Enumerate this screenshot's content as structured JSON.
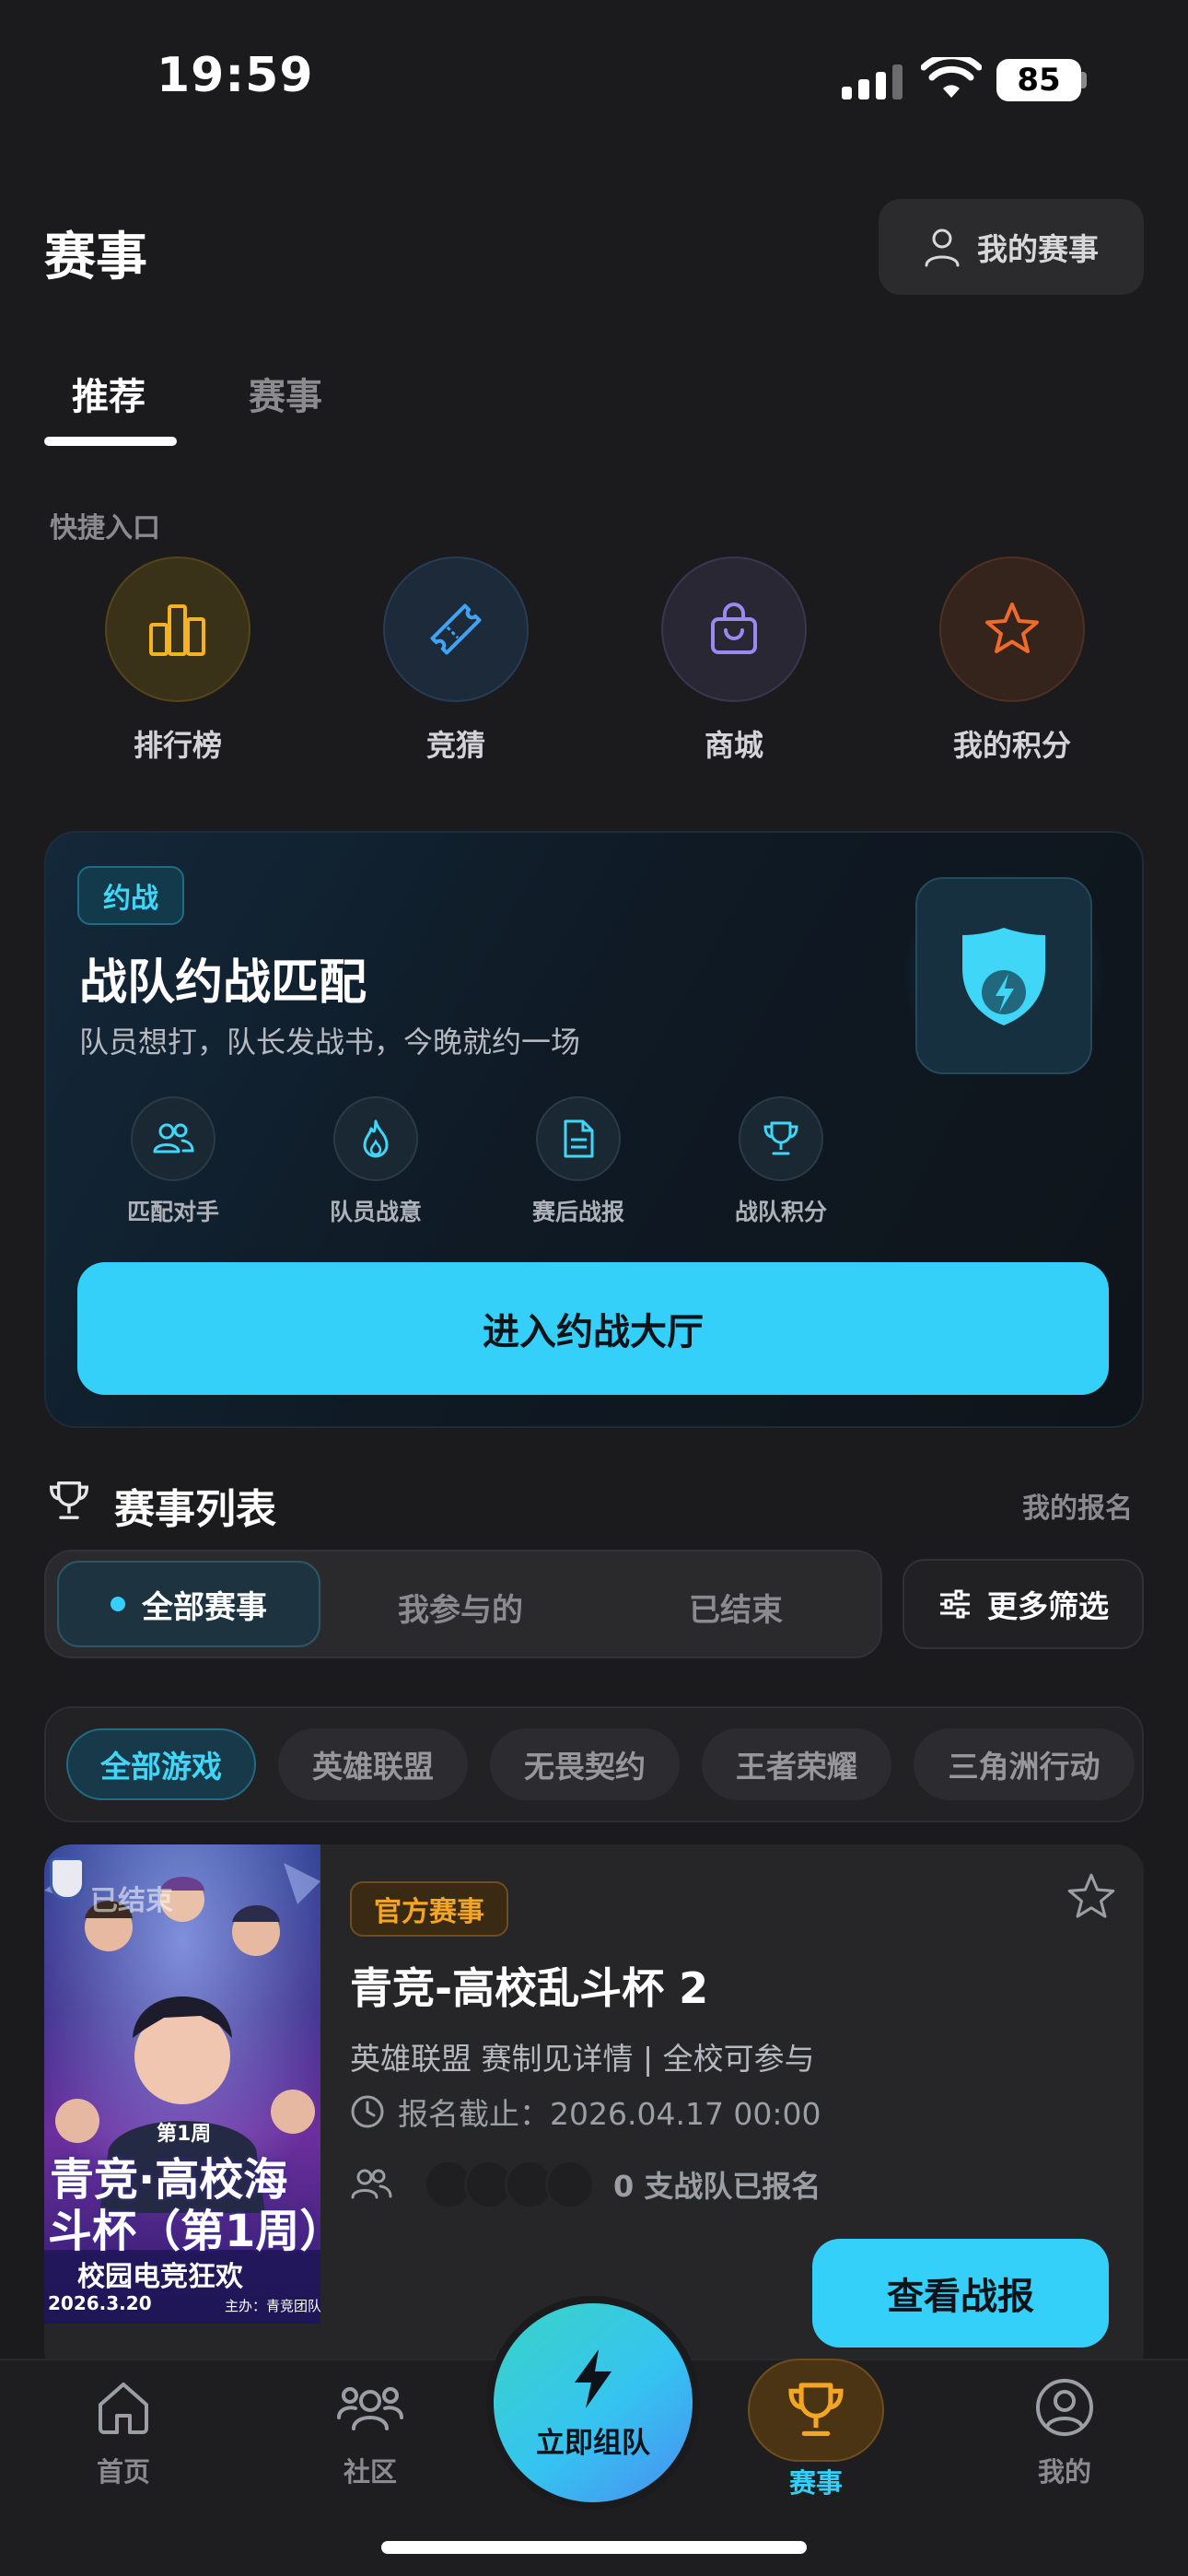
{
  "status_bar": {
    "time": "19:59",
    "battery": "85"
  },
  "header": {
    "title": "赛事",
    "my_events_label": "我的赛事"
  },
  "tabs": [
    {
      "label": "推荐"
    },
    {
      "label": "赛事"
    }
  ],
  "quick_entry": {
    "label": "快捷入口",
    "items": [
      {
        "label": "排行榜",
        "icon": "bar-chart-icon",
        "color": "#f5b324"
      },
      {
        "label": "竞猜",
        "icon": "ticket-icon",
        "color": "#3fa4f7"
      },
      {
        "label": "商城",
        "icon": "shopping-bag-icon",
        "color": "#9a8af0"
      },
      {
        "label": "我的积分",
        "icon": "star-icon",
        "color": "#f06a2a"
      }
    ]
  },
  "battle_card": {
    "badge": "约战",
    "title": "战队约战匹配",
    "subtitle": "队员想打，队长发战书，今晚就约一场",
    "features": [
      {
        "label": "匹配对手",
        "icon": "users-icon"
      },
      {
        "label": "队员战意",
        "icon": "flame-icon"
      },
      {
        "label": "赛后战报",
        "icon": "document-icon"
      },
      {
        "label": "战队积分",
        "icon": "trophy-icon"
      }
    ],
    "button_label": "进入约战大厅"
  },
  "event_list": {
    "title": "赛事列表",
    "my_signup": "我的报名",
    "filters": [
      "全部赛事",
      "我参与的",
      "已结束"
    ],
    "more_filter": "更多筛选",
    "games": [
      "全部游戏",
      "英雄联盟",
      "无畏契约",
      "王者荣耀",
      "三角洲行动"
    ]
  },
  "event_card": {
    "poster": {
      "status": "已结束",
      "week": "第1周",
      "line1": "青竞·高校海",
      "line2": "斗杯（第1周）",
      "slogan": "校园电竞狂欢",
      "date": "2026.3.20",
      "host": "主办：青竞团队"
    },
    "badge": "官方赛事",
    "title": "青竞-高校乱斗杯 2",
    "meta": "英雄联盟 赛制见详情 | 全校可参与",
    "deadline": "报名截止：2026.04.17 00:00",
    "teams_count": "0 支战队已报名",
    "button_label": "查看战报"
  },
  "bottom_nav": {
    "items": [
      {
        "label": "首页",
        "icon": "home-icon"
      },
      {
        "label": "社区",
        "icon": "community-icon"
      },
      {
        "label": "赛事",
        "icon": "trophy-icon",
        "active": true
      },
      {
        "label": "我的",
        "icon": "profile-icon"
      }
    ],
    "fab_label": "立即组队"
  }
}
